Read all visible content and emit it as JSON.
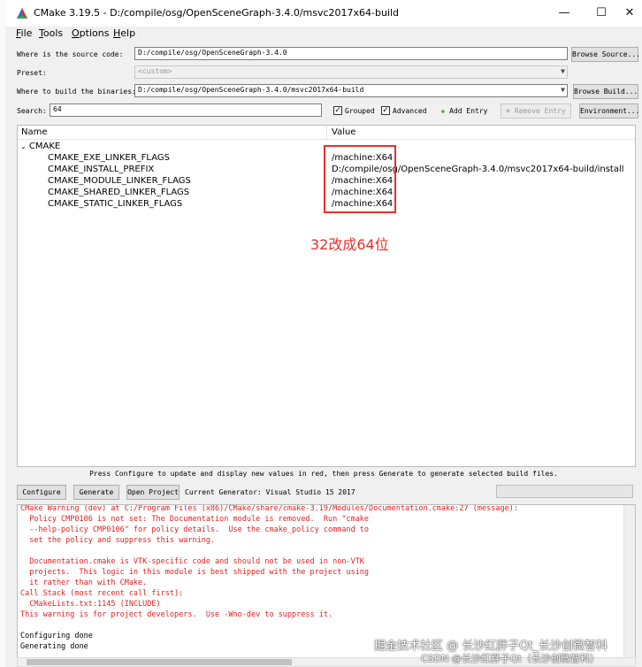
{
  "window": {
    "title": "CMake 3.19.5 - D:/compile/osg/OpenSceneGraph-3.4.0/msvc2017x64-build"
  },
  "window_controls": {
    "minimize": "—",
    "maximize": "☐",
    "close": "✕"
  },
  "menu": [
    {
      "u": "F",
      "rest": "ile"
    },
    {
      "u": "T",
      "rest": "ools"
    },
    {
      "u": "O",
      "rest": "ptions"
    },
    {
      "u": "H",
      "rest": "elp"
    }
  ],
  "source": {
    "label": "Where is the source code:",
    "value": "D:/compile/osg/OpenSceneGraph-3.4.0",
    "button": "Browse Source..."
  },
  "preset": {
    "label": "Preset:",
    "value": "<custom>"
  },
  "build": {
    "label": "Where to build the binaries:",
    "value": "D:/compile/osg/OpenSceneGraph-3.4.0/msvc2017x64-build",
    "button": "Browse Build..."
  },
  "search": {
    "label": "Search:",
    "value": "64"
  },
  "options": {
    "grouped": "Grouped",
    "grouped_checked": true,
    "advanced": "Advanced",
    "advanced_checked": true
  },
  "buttons": {
    "add_entry": "Add Entry",
    "remove_entry": "Remove Entry",
    "environment": "Environment..."
  },
  "table": {
    "col_name": "Name",
    "col_value": "Value",
    "group": "CMAKE",
    "rows": [
      {
        "name": "CMAKE_EXE_LINKER_FLAGS",
        "value": "/machine:X64"
      },
      {
        "name": "CMAKE_INSTALL_PREFIX",
        "value": "D:/compile/osg/OpenSceneGraph-3.4.0/msvc2017x64-build/install"
      },
      {
        "name": "CMAKE_MODULE_LINKER_FLAGS",
        "value": "/machine:X64"
      },
      {
        "name": "CMAKE_SHARED_LINKER_FLAGS",
        "value": "/machine:X64"
      },
      {
        "name": "CMAKE_STATIC_LINKER_FLAGS",
        "value": "/machine:X64"
      }
    ]
  },
  "annotation": {
    "text": "32改成64位",
    "color": "#e8302a"
  },
  "status_message": "Press Configure to update and display new values in red, then press Generate to generate selected build files.",
  "actions": {
    "configure": "Configure",
    "generate": "Generate",
    "open_project": "Open Project",
    "current_generator": "Current Generator: Visual Studio 15 2017"
  },
  "output": {
    "warning_color": "#e02020",
    "lines": [
      {
        "text": "CMake Warning (dev) at C:/Program Files (x86)/CMake/share/cmake-3.19/Modules/Documentation.cmake:27 (message):",
        "red": true
      },
      {
        "text": "  Policy CMP0106 is not set: The Documentation module is removed.  Run \"cmake",
        "red": true
      },
      {
        "text": "  --help-policy CMP0106\" for policy details.  Use the cmake_policy command to",
        "red": true
      },
      {
        "text": "  set the policy and suppress this warning.",
        "red": true
      },
      {
        "text": "",
        "red": true
      },
      {
        "text": "  Documentation.cmake is VTK-specific code and should not be used in non-VTK",
        "red": true
      },
      {
        "text": "  projects.  This logic in this module is best shipped with the project using",
        "red": true
      },
      {
        "text": "  it rather than with CMake.",
        "red": true
      },
      {
        "text": "Call Stack (most recent call first):",
        "red": true
      },
      {
        "text": "  CMakeLists.txt:1145 (INCLUDE)",
        "red": true
      },
      {
        "text": "This warning is for project developers.  Use -Wno-dev to suppress it.",
        "red": true
      },
      {
        "text": "",
        "red": false
      },
      {
        "text": "Configuring done",
        "red": false
      },
      {
        "text": "Generating done",
        "red": false
      }
    ]
  },
  "watermarks": {
    "line1": "掘金技术社区 @ 长沙红胖子Qt_长沙创微智科",
    "line2": "CSDN @长沙红胖子Qt（长沙创微智科）"
  }
}
